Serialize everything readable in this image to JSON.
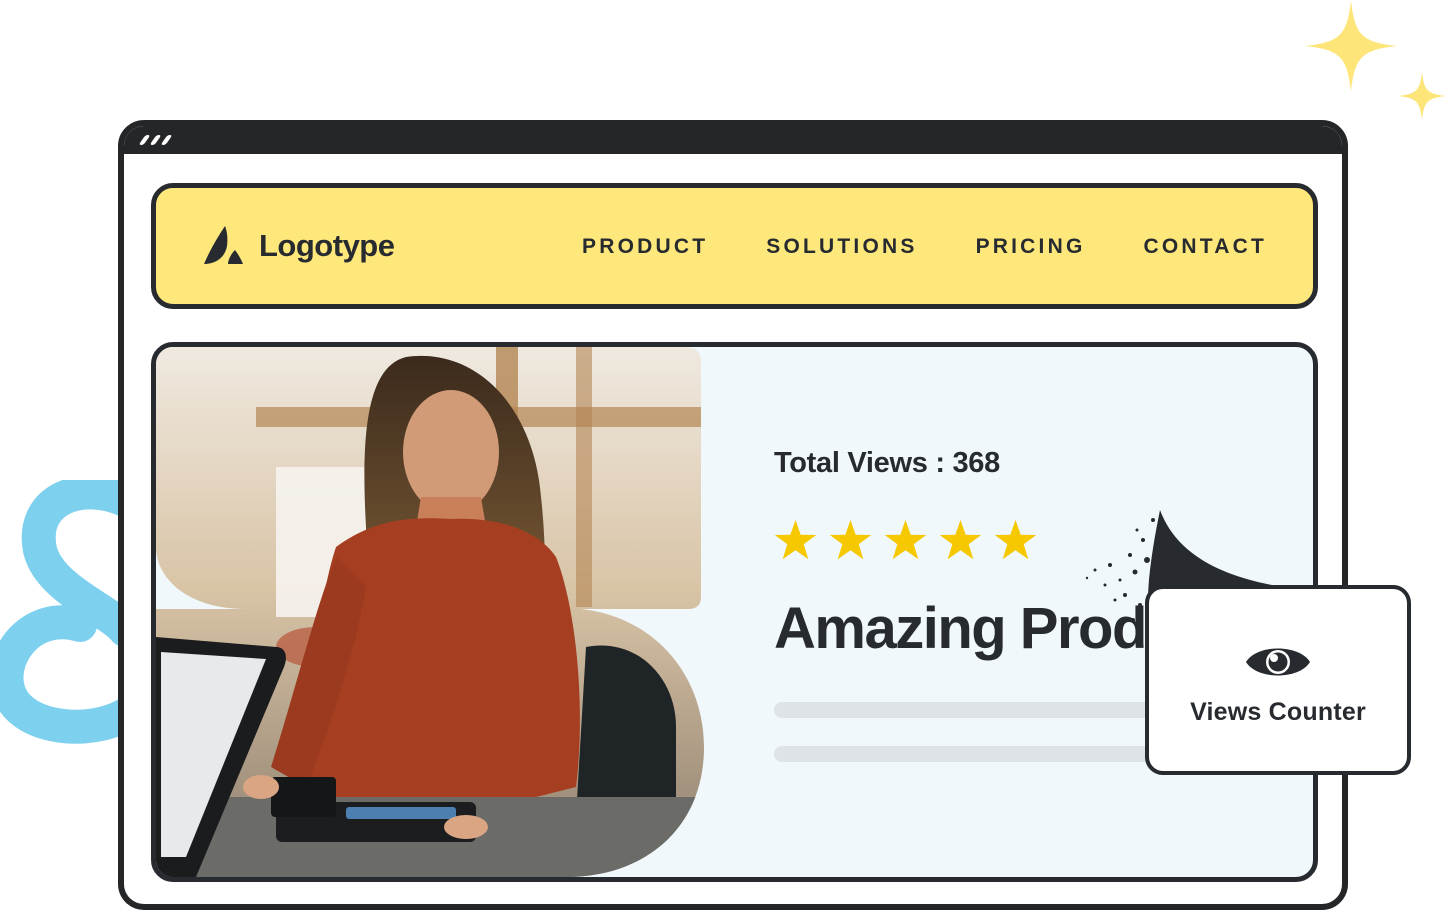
{
  "browser": {
    "window_dots": 3
  },
  "navbar": {
    "logo_text": "Logotype",
    "logo_icon": "logo-mark-icon",
    "links": [
      {
        "label": "PRODUCT"
      },
      {
        "label": "SOLUTIONS"
      },
      {
        "label": "PRICING"
      },
      {
        "label": "CONTACT"
      }
    ]
  },
  "hero": {
    "photo_description": "Woman in red sweater paying with card at a point-of-sale terminal in a salon",
    "total_views_text": "Total Views : 368",
    "total_views_value": 368,
    "rating": {
      "value": 5,
      "max": 5
    },
    "headline": "Amazing Product",
    "placeholder_lines": 2
  },
  "views_card": {
    "icon": "eye-icon",
    "label": "Views Counter"
  },
  "colors": {
    "nav_background": "#fee77b",
    "outline": "#272b30",
    "hero_background": "#f0f8fc",
    "star": "#f5c800",
    "sparkle": "#fde57a",
    "squiggle": "#7dd0ee",
    "placeholder_bar": "#dde3e6"
  }
}
